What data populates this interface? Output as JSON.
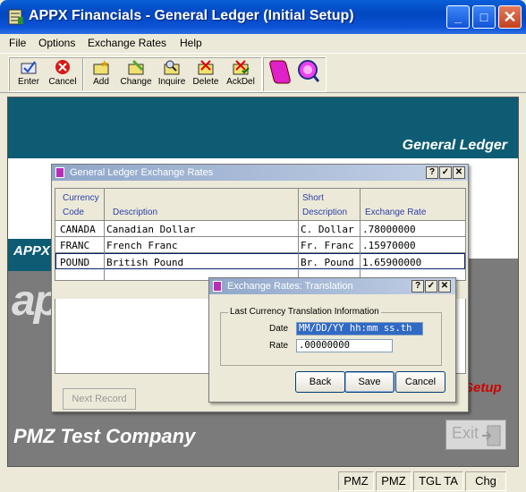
{
  "window": {
    "title": "APPX Financials - General Ledger (Initial Setup)",
    "min_glyph": "_",
    "max_glyph": "□",
    "close_glyph": "✕"
  },
  "menu": [
    "File",
    "Options",
    "Exchange Rates",
    "Help"
  ],
  "toolbar": {
    "buttons": [
      {
        "label": "Enter",
        "icon": "enter-icon"
      },
      {
        "label": "Cancel",
        "icon": "cancel-icon"
      },
      {
        "label": "Add",
        "icon": "add-icon"
      },
      {
        "label": "Change",
        "icon": "change-icon"
      },
      {
        "label": "Inquire",
        "icon": "inquire-icon"
      },
      {
        "label": "Delete",
        "icon": "delete-icon"
      },
      {
        "label": "AckDel",
        "icon": "ackdel-icon"
      }
    ],
    "extra_icons": [
      "scroll-icon",
      "magnifier-icon"
    ]
  },
  "background": {
    "gl_label": "General Ledger",
    "appx_label": "APPX",
    "ap_big": "ap",
    "setup_label": "Setup",
    "company": "PMZ Test Company",
    "exit_label": "Exit"
  },
  "rates_window": {
    "title": "General Ledger Exchange Rates",
    "buttons": [
      "?",
      "✓",
      "✕"
    ],
    "headers": {
      "currency_code": [
        "Currency",
        "Code"
      ],
      "description": "Description",
      "short_description": [
        "Short",
        "Description"
      ],
      "exchange_rate": "Exchange Rate"
    },
    "rows": [
      {
        "code": "CANADA",
        "description": "Canadian Dollar",
        "short": "C. Dollar",
        "rate": ".78000000"
      },
      {
        "code": "FRANC",
        "description": "French Franc",
        "short": "Fr. Franc",
        "rate": ".15970000"
      },
      {
        "code": "POUND",
        "description": "British Pound",
        "short": "Br. Pound",
        "rate": "1.65900000"
      }
    ],
    "next_record": "Next Record"
  },
  "translation_dialog": {
    "title": "Exchange Rates: Translation",
    "buttons": [
      "?",
      "✓",
      "✕"
    ],
    "group_label": "Last Currency Translation Information",
    "date_label": "Date",
    "date_value": "MM/DD/YY hh:mm ss.th",
    "rate_label": "Rate",
    "rate_value": ".00000000",
    "back": "Back",
    "save": "Save",
    "cancel": "Cancel"
  },
  "status": [
    "PMZ",
    "PMZ",
    "TGL TA",
    "Chg"
  ],
  "colors": {
    "teal": "#0e5c73",
    "titlebar": "#0047c0",
    "header_text": "#2c3fa8",
    "setup_red": "#d00000",
    "selection": "#316ac5"
  }
}
